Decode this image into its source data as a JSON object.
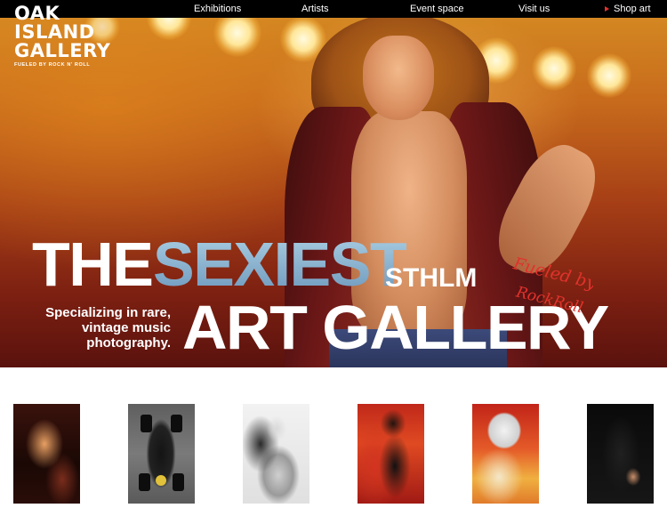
{
  "brand": {
    "logo_line1": "OAK",
    "logo_line2": "ISLAND",
    "logo_line3": "GALLERY",
    "logo_tagline": "FUELED BY ROCK N' ROLL"
  },
  "nav": {
    "items": [
      "Exhibitions",
      "Artists",
      "Event space",
      "Visit us"
    ],
    "shop": "Shop art"
  },
  "hero": {
    "headline_word1": "THE",
    "headline_word2": "SEXIEST",
    "headline_small": "STHLM",
    "headline_line2": "ART GALLERY",
    "tagline": "Specializing in rare, vintage music photography.",
    "script_line1": "Fueled by",
    "script_line2": "RockRoll"
  },
  "thumbnails": {
    "count": 6
  },
  "colors": {
    "nav_background": "#000000",
    "accent_red": "#e5322d",
    "headline_blue": "#8ab4cf",
    "text_white": "#ffffff"
  },
  "icons": {
    "shop_marker": "triangle-right-icon"
  }
}
